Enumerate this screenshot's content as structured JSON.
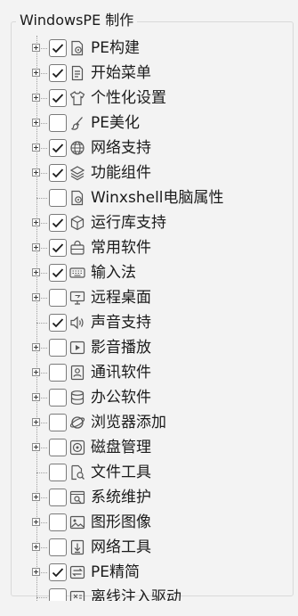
{
  "group": {
    "title": "WindowsPE 制作"
  },
  "items": [
    {
      "label": "PE构建",
      "checked": true,
      "expandable": true,
      "icon": "settings-doc-icon"
    },
    {
      "label": "开始菜单",
      "checked": true,
      "expandable": true,
      "icon": "list-doc-icon"
    },
    {
      "label": "个性化设置",
      "checked": true,
      "expandable": true,
      "icon": "tshirt-icon"
    },
    {
      "label": "PE美化",
      "checked": false,
      "expandable": true,
      "icon": "brush-icon"
    },
    {
      "label": "网络支持",
      "checked": true,
      "expandable": true,
      "icon": "globe-icon"
    },
    {
      "label": "功能组件",
      "checked": true,
      "expandable": true,
      "icon": "layers-icon"
    },
    {
      "label": "Winxshell电脑属性",
      "checked": false,
      "expandable": false,
      "icon": "settings-doc-icon"
    },
    {
      "label": "运行库支持",
      "checked": true,
      "expandable": true,
      "icon": "cube-icon"
    },
    {
      "label": "常用软件",
      "checked": true,
      "expandable": true,
      "icon": "bag-icon"
    },
    {
      "label": "输入法",
      "checked": true,
      "expandable": true,
      "icon": "keyboard-icon"
    },
    {
      "label": "远程桌面",
      "checked": false,
      "expandable": true,
      "icon": "remote-desktop-icon"
    },
    {
      "label": "声音支持",
      "checked": true,
      "expandable": false,
      "icon": "speaker-icon"
    },
    {
      "label": "影音播放",
      "checked": false,
      "expandable": true,
      "icon": "video-play-icon"
    },
    {
      "label": "通讯软件",
      "checked": false,
      "expandable": true,
      "icon": "contact-icon"
    },
    {
      "label": "办公软件",
      "checked": false,
      "expandable": true,
      "icon": "briefcase-icon"
    },
    {
      "label": "浏览器添加",
      "checked": false,
      "expandable": true,
      "icon": "browser-icon"
    },
    {
      "label": "磁盘管理",
      "checked": false,
      "expandable": true,
      "icon": "disk-icon"
    },
    {
      "label": "文件工具",
      "checked": false,
      "expandable": false,
      "icon": "file-search-icon"
    },
    {
      "label": "系统维护",
      "checked": false,
      "expandable": true,
      "icon": "system-tool-icon"
    },
    {
      "label": "图形图像",
      "checked": false,
      "expandable": true,
      "icon": "image-icon"
    },
    {
      "label": "网络工具",
      "checked": false,
      "expandable": true,
      "icon": "download-icon"
    },
    {
      "label": "PE精简",
      "checked": true,
      "expandable": true,
      "icon": "slim-icon"
    },
    {
      "label": "离线注入驱动",
      "checked": false,
      "expandable": false,
      "icon": "driver-icon"
    }
  ],
  "colors": {
    "check": "#1b1b1b",
    "tree_line": "#a0a0a0",
    "background": "#f3f3f3"
  }
}
